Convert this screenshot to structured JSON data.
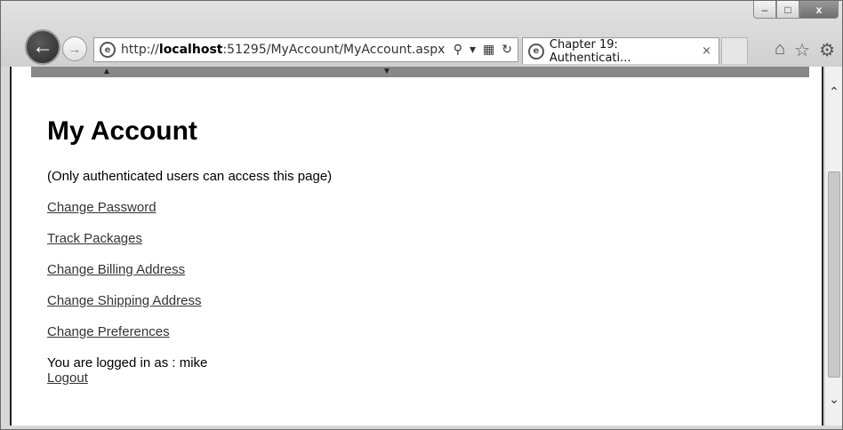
{
  "window_controls": {
    "minimize": "–",
    "maximize": "□",
    "close": "x"
  },
  "address_bar": {
    "url_prefix": "http://",
    "url_host": "localhost",
    "url_rest": ":51295/MyAccount/MyAccount.aspx"
  },
  "tab": {
    "title": "Chapter 19: Authenticati...",
    "close": "×"
  },
  "page": {
    "title": "My Account",
    "note": "(Only authenticated users can access this page)",
    "links": [
      "Change Password",
      "Track Packages",
      "Change Billing Address",
      "Change Shipping Address",
      "Change Preferences"
    ],
    "logged_in_text": "You are logged in as : mike",
    "logout": "Logout"
  }
}
